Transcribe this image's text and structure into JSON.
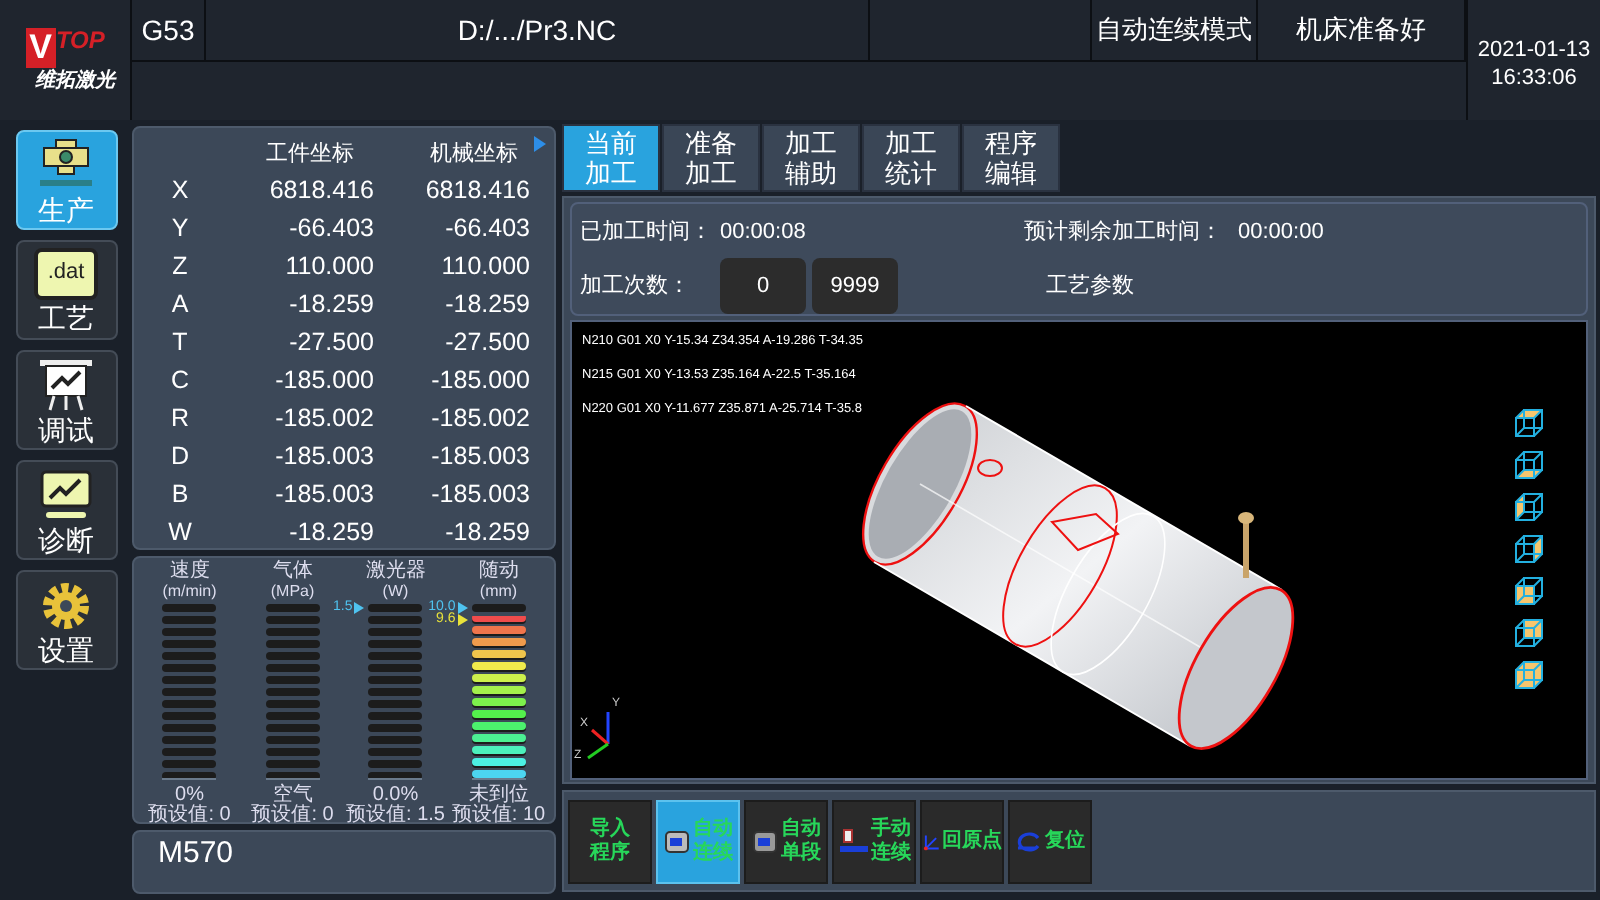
{
  "logo": {
    "mark": "V",
    "brand": "TOP",
    "name": "维拓激光"
  },
  "header": {
    "code": "G53",
    "file": "D:/.../Pr3.NC",
    "mode": "自动连续模式",
    "machine_state": "机床准备好",
    "date": "2021-01-13",
    "time": "16:33:06"
  },
  "sidebar": {
    "items": [
      {
        "label": "生产",
        "kind": "production",
        "selected": true
      },
      {
        "label": "工艺",
        "kind": "process",
        "badge": ".dat",
        "selected": false
      },
      {
        "label": "调试",
        "kind": "debug",
        "selected": false
      },
      {
        "label": "诊断",
        "kind": "diagnose",
        "selected": false
      },
      {
        "label": "设置",
        "kind": "settings",
        "selected": false
      }
    ]
  },
  "coordinates": {
    "columns": [
      "工件坐标",
      "机械坐标"
    ],
    "rows": [
      {
        "axis": "X",
        "work": "6818.416",
        "machine": "6818.416"
      },
      {
        "axis": "Y",
        "work": "-66.403",
        "machine": "-66.403"
      },
      {
        "axis": "Z",
        "work": "110.000",
        "machine": "110.000"
      },
      {
        "axis": "A",
        "work": "-18.259",
        "machine": "-18.259"
      },
      {
        "axis": "T",
        "work": "-27.500",
        "machine": "-27.500"
      },
      {
        "axis": "C",
        "work": "-185.000",
        "machine": "-185.000"
      },
      {
        "axis": "R",
        "work": "-185.002",
        "machine": "-185.002"
      },
      {
        "axis": "D",
        "work": "-185.003",
        "machine": "-185.003"
      },
      {
        "axis": "B",
        "work": "-185.003",
        "machine": "-185.003"
      },
      {
        "axis": "W",
        "work": "-18.259",
        "machine": "-18.259"
      }
    ]
  },
  "gauges": [
    {
      "title": "速度",
      "unit": "(m/min)",
      "level": 0,
      "reading": "0%",
      "preset": "预设值: 0"
    },
    {
      "title": "气体",
      "unit": "(MPa)",
      "level": 0,
      "reading": "空气",
      "preset": "预设值: 0"
    },
    {
      "title": "激光器",
      "unit": "(W)",
      "level": 0,
      "reading": "0.0%",
      "preset": "预设值: 1.5",
      "markers": [
        {
          "label": "1.5",
          "color": "#4fc3f0"
        }
      ]
    },
    {
      "title": "随动",
      "unit": "(mm)",
      "level": 0.933,
      "reading": "未到位",
      "preset": "预设值: 10",
      "markers": [
        {
          "label": "10.0",
          "color": "#4fc3f0"
        },
        {
          "label": "9.6",
          "color": "#e8e23a"
        }
      ]
    }
  ],
  "message": "M570",
  "tabs": [
    {
      "lines": [
        "当前",
        "加工"
      ],
      "selected": true
    },
    {
      "lines": [
        "准备",
        "加工"
      ],
      "selected": false
    },
    {
      "lines": [
        "加工",
        "辅助"
      ],
      "selected": false
    },
    {
      "lines": [
        "加工",
        "统计"
      ],
      "selected": false
    },
    {
      "lines": [
        "程序",
        "编辑"
      ],
      "selected": false
    }
  ],
  "info": {
    "elapsed_label": "已加工时间：",
    "elapsed": "00:00:08",
    "remaining_label": "预计剩余加工时间：",
    "remaining": "00:00:00",
    "count_label": "加工次数：",
    "count": "0",
    "count_target": "9999",
    "params_label": "工艺参数"
  },
  "viewport": {
    "gcode": [
      "N210 G01 X0 Y-15.34 Z34.354 A-19.286 T-34.35",
      "N215 G01 X0 Y-13.53 Z35.164 A-22.5 T-35.164",
      "N220 G01 X0 Y-11.677 Z35.871 A-25.714 T-35.8"
    ],
    "axes": [
      "X",
      "Y",
      "Z"
    ],
    "view_cubes": [
      {
        "kind": "top"
      },
      {
        "kind": "bottom"
      },
      {
        "kind": "left"
      },
      {
        "kind": "right"
      },
      {
        "kind": "front"
      },
      {
        "kind": "back"
      },
      {
        "kind": "iso"
      }
    ]
  },
  "buttons": [
    {
      "lines": [
        "导入",
        "程序"
      ],
      "kind": "import",
      "selected": false
    },
    {
      "lines": [
        "自动",
        "连续"
      ],
      "kind": "auto",
      "selected": true
    },
    {
      "lines": [
        "自动",
        "单段"
      ],
      "kind": "single",
      "selected": false
    },
    {
      "lines": [
        "手动",
        "连续"
      ],
      "kind": "manual",
      "selected": false
    },
    {
      "lines": [
        "回原点"
      ],
      "kind": "home",
      "selected": false
    },
    {
      "lines": [
        "复位"
      ],
      "kind": "reset",
      "selected": false
    }
  ]
}
